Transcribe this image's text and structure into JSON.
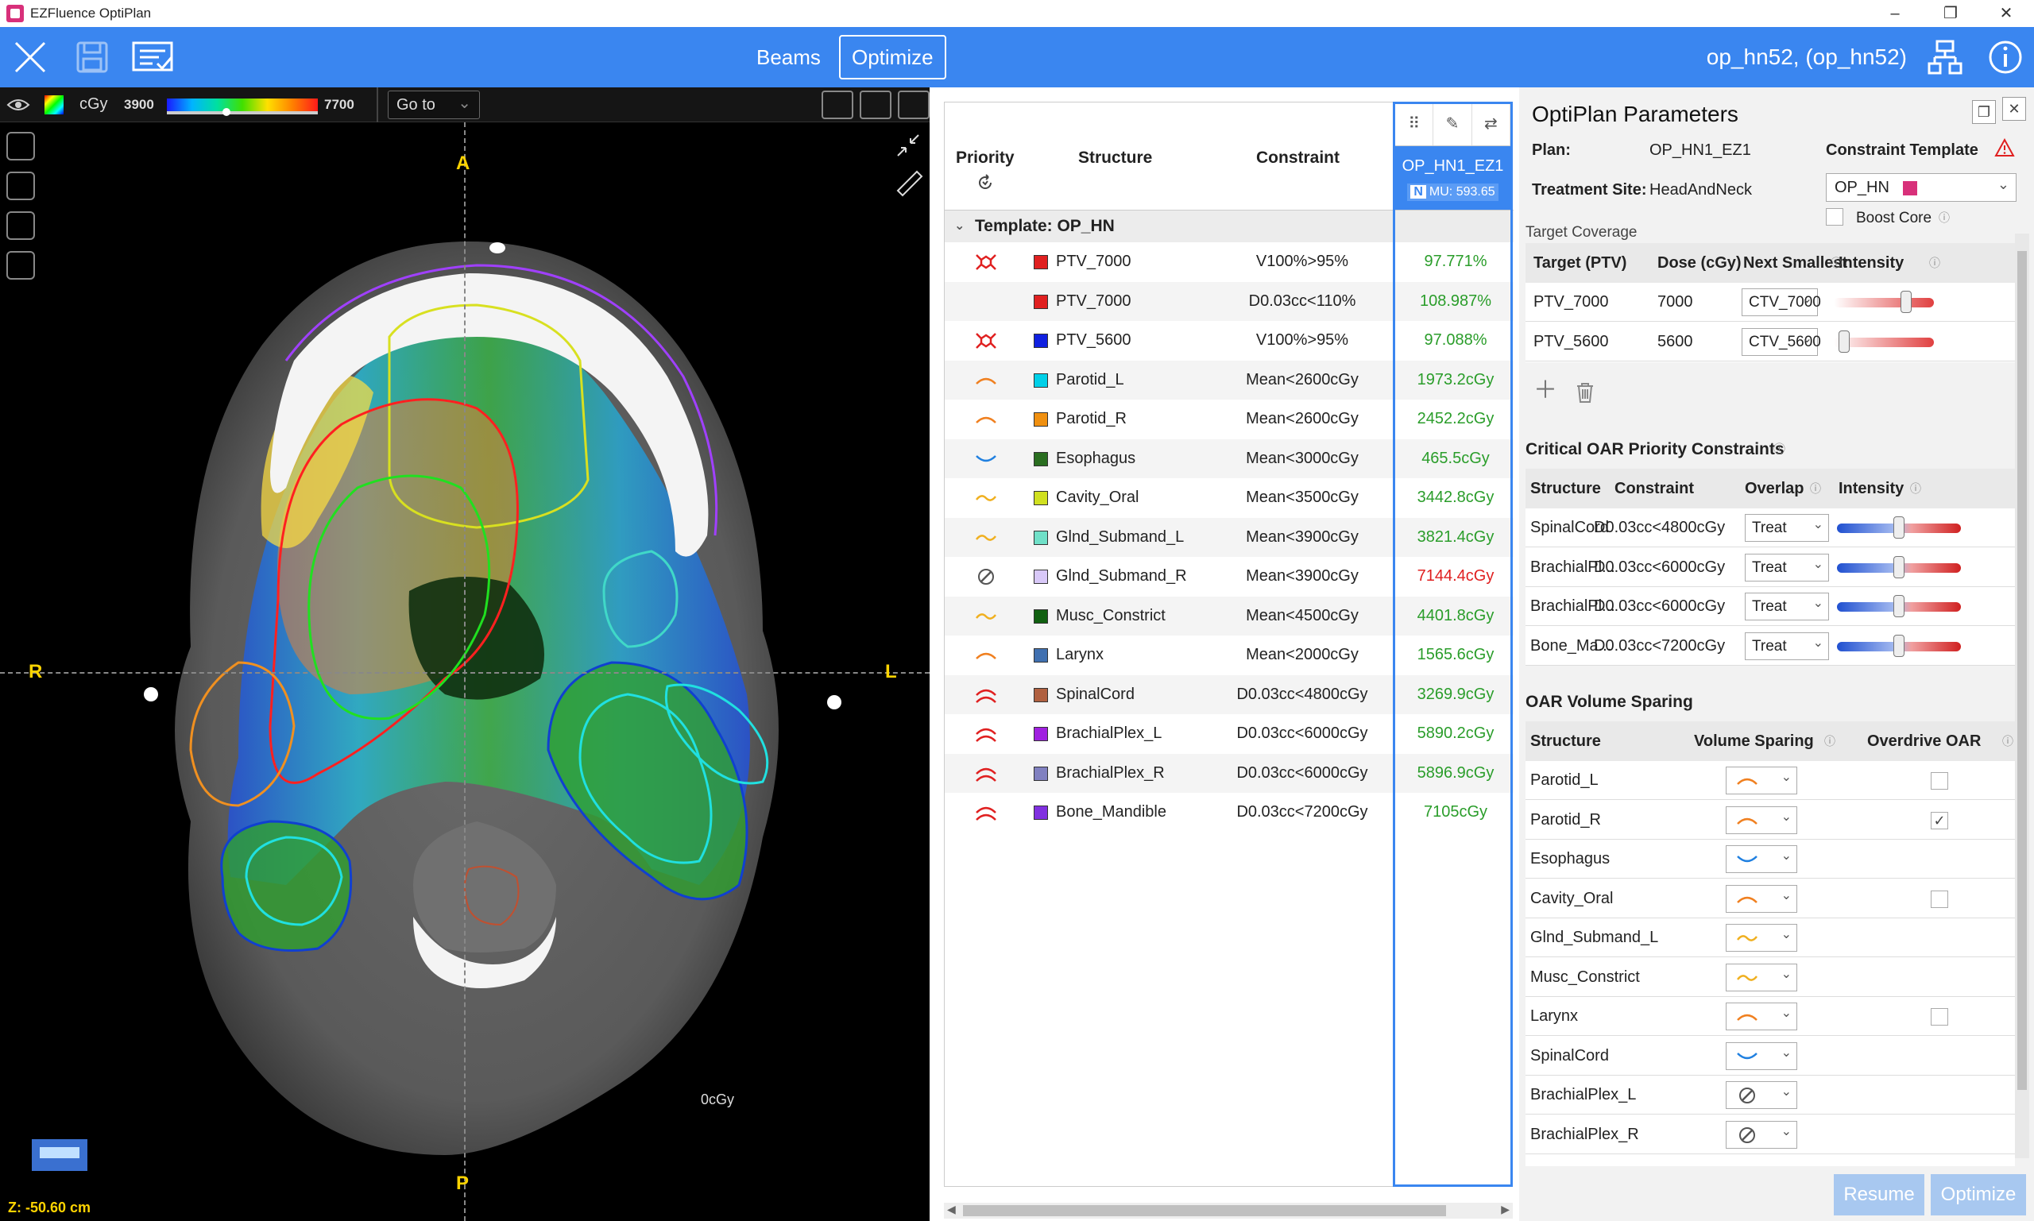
{
  "app": {
    "title": "EZFluence OptiPlan",
    "window_controls": [
      "–",
      "❐",
      "✕"
    ]
  },
  "toolbar": {
    "beams_label": "Beams",
    "optimize_label": "Optimize",
    "plan_label": "op_hn52,  (op_hn52)"
  },
  "viewer": {
    "unit": "cGy",
    "dose_min": "3900",
    "dose_max": "7700",
    "goto_label": "Go to",
    "orient_anterior": "A",
    "orient_posterior": "P",
    "orient_right": "R",
    "orient_left": "L",
    "z_label": "Z: -50.60 cm",
    "overlay_label": "0cGy"
  },
  "constraints": {
    "headers": {
      "priority": "Priority",
      "structure": "Structure",
      "constraint": "Constraint"
    },
    "template_label": "Template: OP_HN",
    "plan_name": "OP_HN1_EZ1",
    "plan_mu_badge": "N",
    "plan_mu": "MU: 593.65",
    "rows": [
      {
        "prio": "core",
        "color": "#e02020",
        "structure": "PTV_7000",
        "constraint": "V100%>95%",
        "result": "97.771%",
        "bad": false
      },
      {
        "prio": "none",
        "color": "#e02020",
        "structure": "PTV_7000",
        "constraint": "D0.03cc<110%",
        "result": "108.987%",
        "bad": false
      },
      {
        "prio": "core",
        "color": "#1020e0",
        "structure": "PTV_5600",
        "constraint": "V100%>95%",
        "result": "97.088%",
        "bad": false
      },
      {
        "prio": "up",
        "color": "#00d0e8",
        "structure": "Parotid_L",
        "constraint": "Mean<2600cGy",
        "result": "1973.2cGy",
        "bad": false
      },
      {
        "prio": "up",
        "color": "#f09010",
        "structure": "Parotid_R",
        "constraint": "Mean<2600cGy",
        "result": "2452.2cGy",
        "bad": false
      },
      {
        "prio": "down",
        "color": "#2a6e20",
        "structure": "Esophagus",
        "constraint": "Mean<3000cGy",
        "result": "465.5cGy",
        "bad": false
      },
      {
        "prio": "wave",
        "color": "#d0e020",
        "structure": "Cavity_Oral",
        "constraint": "Mean<3500cGy",
        "result": "3442.8cGy",
        "bad": false
      },
      {
        "prio": "wave",
        "color": "#70e0c8",
        "structure": "Glnd_Submand_L",
        "constraint": "Mean<3900cGy",
        "result": "3821.4cGy",
        "bad": false
      },
      {
        "prio": "off",
        "color": "#d8c8f8",
        "structure": "Glnd_Submand_R",
        "constraint": "Mean<3900cGy",
        "result": "7144.4cGy",
        "bad": true
      },
      {
        "prio": "wave",
        "color": "#106010",
        "structure": "Musc_Constrict",
        "constraint": "Mean<4500cGy",
        "result": "4401.8cGy",
        "bad": false
      },
      {
        "prio": "up",
        "color": "#4070b0",
        "structure": "Larynx",
        "constraint": "Mean<2000cGy",
        "result": "1565.6cGy",
        "bad": false
      },
      {
        "prio": "double",
        "color": "#b06040",
        "structure": "SpinalCord",
        "constraint": "D0.03cc<4800cGy",
        "result": "3269.9cGy",
        "bad": false
      },
      {
        "prio": "double",
        "color": "#a020e0",
        "structure": "BrachialPlex_L",
        "constraint": "D0.03cc<6000cGy",
        "result": "5890.2cGy",
        "bad": false
      },
      {
        "prio": "double",
        "color": "#8080c0",
        "structure": "BrachialPlex_R",
        "constraint": "D0.03cc<6000cGy",
        "result": "5896.9cGy",
        "bad": false
      },
      {
        "prio": "double",
        "color": "#8030e0",
        "structure": "Bone_Mandible",
        "constraint": "D0.03cc<7200cGy",
        "result": "7105cGy",
        "bad": false
      }
    ]
  },
  "params": {
    "title": "OptiPlan Parameters",
    "plan_key": "Plan:",
    "plan_value": "OP_HN1_EZ1",
    "site_key": "Treatment Site:",
    "site_value": "HeadAndNeck",
    "template_key": "Constraint Template",
    "template_value": "OP_HN",
    "boost_core": "Boost Core",
    "target_section": "Target Coverage",
    "target_headers": {
      "ptv": "Target (PTV)",
      "dose": "Dose (cGy)",
      "next": "Next Smallest",
      "intensity": "Intensity"
    },
    "targets": [
      {
        "ptv": "PTV_7000",
        "dose": "7000",
        "next": "CTV_7000",
        "intensity": 0.75
      },
      {
        "ptv": "PTV_5600",
        "dose": "5600",
        "next": "CTV_5600",
        "intensity": 0.05
      }
    ],
    "oar_section": "Critical OAR Priority Constraints",
    "oar_headers": {
      "structure": "Structure",
      "constraint": "Constraint",
      "overlap": "Overlap",
      "intensity": "Intensity"
    },
    "oars": [
      {
        "structure": "SpinalCord",
        "constraint": "D0.03cc<4800cGy",
        "overlap": "Treat",
        "intensity": 0.5
      },
      {
        "structure": "BrachialPl...",
        "constraint": "D0.03cc<6000cGy",
        "overlap": "Treat",
        "intensity": 0.5
      },
      {
        "structure": "BrachialPl...",
        "constraint": "D0.03cc<6000cGy",
        "overlap": "Treat",
        "intensity": 0.5
      },
      {
        "structure": "Bone_Ma...",
        "constraint": "D0.03cc<7200cGy",
        "overlap": "Treat",
        "intensity": 0.5
      }
    ],
    "sparing_section": "OAR Volume Sparing",
    "sparing_headers": {
      "structure": "Structure",
      "volume": "Volume Sparing",
      "overdrive": "Overdrive OAR"
    },
    "sparing": [
      {
        "structure": "Parotid_L",
        "prio": "up",
        "overdrive": "unchecked"
      },
      {
        "structure": "Parotid_R",
        "prio": "up",
        "overdrive": "checked"
      },
      {
        "structure": "Esophagus",
        "prio": "down",
        "overdrive": "none"
      },
      {
        "structure": "Cavity_Oral",
        "prio": "up",
        "overdrive": "unchecked"
      },
      {
        "structure": "Glnd_Submand_L",
        "prio": "wave",
        "overdrive": "none"
      },
      {
        "structure": "Musc_Constrict",
        "prio": "wave",
        "overdrive": "none"
      },
      {
        "structure": "Larynx",
        "prio": "up",
        "overdrive": "unchecked"
      },
      {
        "structure": "SpinalCord",
        "prio": "down",
        "overdrive": "none"
      },
      {
        "structure": "BrachialPlex_L",
        "prio": "off",
        "overdrive": "none"
      },
      {
        "structure": "BrachialPlex_R",
        "prio": "off",
        "overdrive": "none"
      }
    ],
    "resume_label": "Resume",
    "optimize_label": "Optimize"
  },
  "colors": {
    "accent": "#3a86f0",
    "good": "#2a9d2a",
    "bad": "#e02020",
    "orange_prio": "#f08020",
    "blue_prio": "#2080e0",
    "wave_prio": "#f0b020",
    "red_prio": "#e02020"
  }
}
